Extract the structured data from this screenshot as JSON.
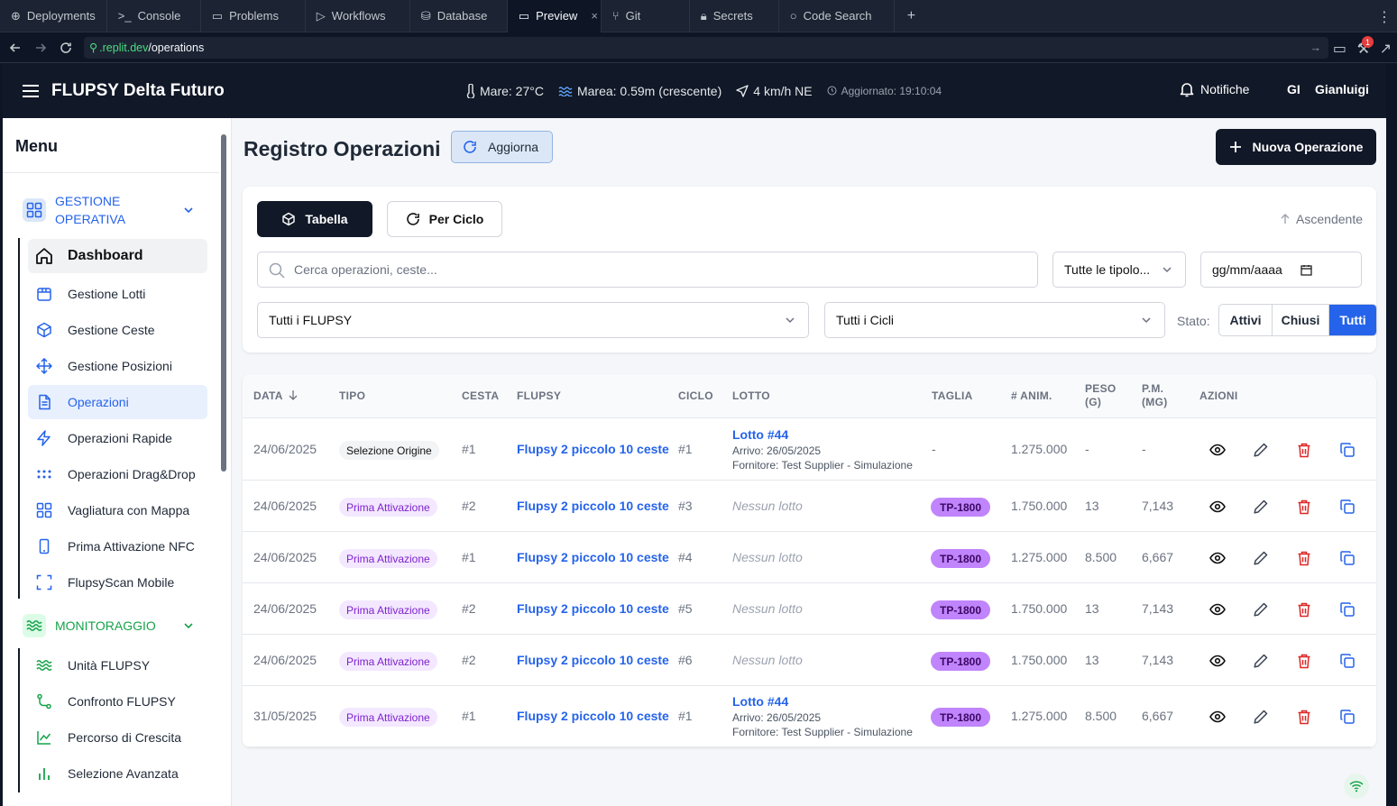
{
  "ide": {
    "tabs": [
      "Deployments",
      "Console",
      "Problems",
      "Workflows",
      "Database",
      "Preview",
      "Git",
      "Secrets",
      "Code Search"
    ],
    "active_tab": "Preview",
    "url_domain": ".replit.dev",
    "url_path": "/operations",
    "notification_count": "1"
  },
  "header": {
    "app_title": "FLUPSY Delta Futuro",
    "sea_temp": "Mare: 27°C",
    "tide": "Marea: 0.59m (crescente)",
    "wind": "4 km/h NE",
    "updated": "Aggiornato: 19:10:04",
    "notifications": "Notifiche",
    "user_initials": "GI",
    "user_name": "Gianluigi"
  },
  "sidebar": {
    "title": "Menu",
    "section1": {
      "label": "GESTIONE OPERATIVA",
      "color": "#2563eb"
    },
    "items1": [
      {
        "label": "Dashboard",
        "icon": "home-icon"
      },
      {
        "label": "Gestione Lotti",
        "icon": "box-icon"
      },
      {
        "label": "Gestione Ceste",
        "icon": "cube-icon"
      },
      {
        "label": "Gestione Posizioni",
        "icon": "move-icon"
      },
      {
        "label": "Operazioni",
        "icon": "file-text-icon"
      },
      {
        "label": "Operazioni Rapide",
        "icon": "zap-icon"
      },
      {
        "label": "Operazioni Drag&Drop",
        "icon": "grip-icon"
      },
      {
        "label": "Vagliatura con Mappa",
        "icon": "grid-icon"
      },
      {
        "label": "Prima Attivazione NFC",
        "icon": "phone-icon"
      },
      {
        "label": "FlupsyScan Mobile",
        "icon": "scan-icon"
      }
    ],
    "section2": {
      "label": "MONITORAGGIO",
      "color": "#16a34a"
    },
    "items2": [
      {
        "label": "Unità FLUPSY",
        "icon": "waves-icon"
      },
      {
        "label": "Confronto FLUPSY",
        "icon": "git-compare-icon"
      },
      {
        "label": "Percorso di Crescita",
        "icon": "line-chart-icon"
      },
      {
        "label": "Selezione Avanzata",
        "icon": "bar-chart-icon"
      }
    ]
  },
  "main": {
    "title": "Registro Operazioni",
    "refresh_label": "Aggiorna",
    "new_operation_label": "Nuova Operazione",
    "view_table": "Tabella",
    "view_cycle": "Per Ciclo",
    "sort_label": "Ascendente",
    "search_placeholder": "Cerca operazioni, ceste...",
    "type_filter": "Tutte le tipolo...",
    "date_placeholder": "gg/mm/aaaa",
    "flupsy_filter": "Tutti i FLUPSY",
    "cycle_filter": "Tutti i Cicli",
    "state_label": "Stato:",
    "state_options": [
      "Attivi",
      "Chiusi",
      "Tutti"
    ],
    "state_selected": "Tutti"
  },
  "table": {
    "columns": [
      "DATA",
      "TIPO",
      "CESTA",
      "FLUPSY",
      "CICLO",
      "LOTTO",
      "TAGLIA",
      "# ANIM.",
      "PESO (G)",
      "P.M. (MG)",
      "AZIONI"
    ],
    "rows": [
      {
        "data": "24/06/2025",
        "tipo": "Selezione Origine",
        "cesta": "#1",
        "flupsy": "Flupsy 2 piccolo 10 ceste",
        "ciclo": "#1",
        "lotto": "Lotto #44",
        "arrivo": "Arrivo: 26/05/2025",
        "fornitore": "Fornitore: Test Supplier - Simulazione",
        "taglia": "-",
        "anim": "1.275.000",
        "peso": "-",
        "pm": "-"
      },
      {
        "data": "24/06/2025",
        "tipo": "Prima Attivazione",
        "cesta": "#2",
        "flupsy": "Flupsy 2 piccolo 10 ceste",
        "ciclo": "#3",
        "lotto": "Nessun lotto",
        "arrivo": "",
        "fornitore": "",
        "taglia": "TP-1800",
        "anim": "1.750.000",
        "peso": "13",
        "pm": "7,143"
      },
      {
        "data": "24/06/2025",
        "tipo": "Prima Attivazione",
        "cesta": "#1",
        "flupsy": "Flupsy 2 piccolo 10 ceste",
        "ciclo": "#4",
        "lotto": "Nessun lotto",
        "arrivo": "",
        "fornitore": "",
        "taglia": "TP-1800",
        "anim": "1.275.000",
        "peso": "8.500",
        "pm": "6,667"
      },
      {
        "data": "24/06/2025",
        "tipo": "Prima Attivazione",
        "cesta": "#2",
        "flupsy": "Flupsy 2 piccolo 10 ceste",
        "ciclo": "#5",
        "lotto": "Nessun lotto",
        "arrivo": "",
        "fornitore": "",
        "taglia": "TP-1800",
        "anim": "1.750.000",
        "peso": "13",
        "pm": "7,143"
      },
      {
        "data": "24/06/2025",
        "tipo": "Prima Attivazione",
        "cesta": "#2",
        "flupsy": "Flupsy 2 piccolo 10 ceste",
        "ciclo": "#6",
        "lotto": "Nessun lotto",
        "arrivo": "",
        "fornitore": "",
        "taglia": "TP-1800",
        "anim": "1.750.000",
        "peso": "13",
        "pm": "7,143"
      },
      {
        "data": "31/05/2025",
        "tipo": "Prima Attivazione",
        "cesta": "#1",
        "flupsy": "Flupsy 2 piccolo 10 ceste",
        "ciclo": "#1",
        "lotto": "Lotto #44",
        "arrivo": "Arrivo: 26/05/2025",
        "fornitore": "Fornitore: Test Supplier - Simulazione",
        "taglia": "TP-1800",
        "anim": "1.275.000",
        "peso": "8.500",
        "pm": "6,667"
      }
    ]
  }
}
